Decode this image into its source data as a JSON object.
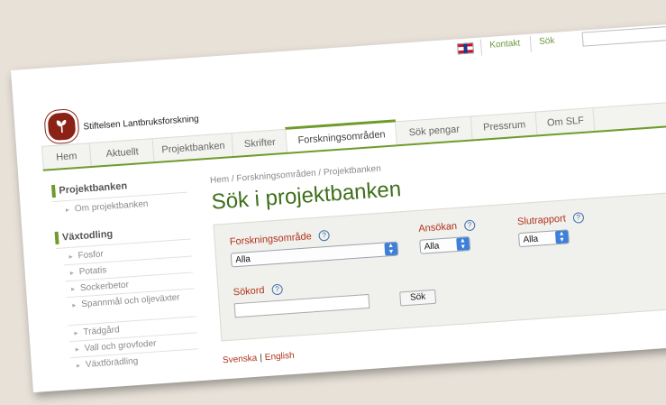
{
  "topbar": {
    "contact": "Kontakt",
    "search_label": "Sök"
  },
  "brand": {
    "org_name": "Stiftelsen Lantbruksforskning"
  },
  "nav": {
    "items": [
      "Hem",
      "Aktuellt",
      "Projektbanken",
      "Skrifter",
      "Forskningsområden",
      "Sök pengar",
      "Pressrum",
      "Om SLF"
    ],
    "active": "Forskningsområden"
  },
  "sidebar": {
    "section1": {
      "title": "Projektbanken",
      "items": [
        "Om projektbanken"
      ]
    },
    "section2": {
      "title": "Växtodling",
      "items": [
        "Fosfor",
        "Potatis",
        "Sockerbetor",
        "Spannmål och oljeväxter",
        "Trädgård",
        "Vall och grovfoder",
        "Växtförädling"
      ]
    }
  },
  "main": {
    "breadcrumb": "Hem / Forskningsområden / Projektbanken",
    "title": "Sök i projektbanken",
    "help_symbol": "?",
    "form": {
      "area_label": "Forskningsområde",
      "area_value": "Alla",
      "application_label": "Ansökan",
      "application_value": "Alla",
      "final_report_label": "Slutrapport",
      "final_report_value": "Alla",
      "keyword_label": "Sökord",
      "keyword_value": "",
      "search_button": "Sök"
    },
    "languages": [
      "Svenska",
      "English"
    ],
    "language_separator": "|"
  },
  "colors": {
    "accent_green": "#6f9b2a",
    "title_green": "#3e6f1b",
    "label_red": "#b0331d",
    "logo_red": "#8a2316",
    "select_blue": "#3d7fd9"
  },
  "icons": [
    "uk-flag-icon",
    "leaf-logo-icon",
    "help-icon",
    "chevron-right-icon",
    "select-caret-icon"
  ]
}
